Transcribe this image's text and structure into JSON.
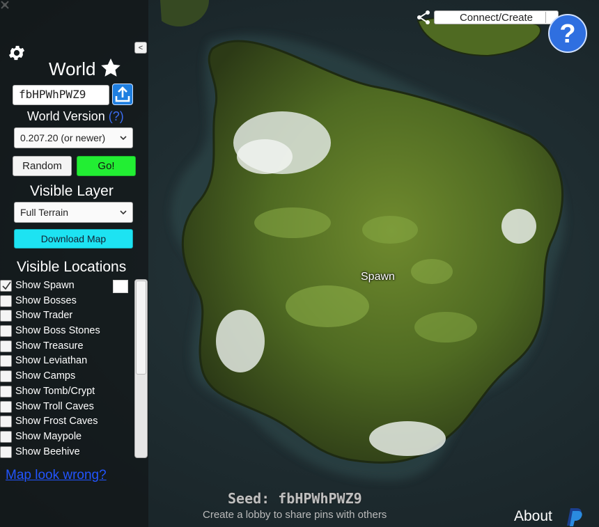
{
  "sidebar": {
    "world_label": "World",
    "collapse_label": "<",
    "seed_value": "fbHPWhPWZ9",
    "world_version_label": "World Version",
    "world_version_help": "(?)",
    "version_selected": "0.207.20 (or newer)",
    "random_label": "Random",
    "go_label": "Go!",
    "visible_layer_label": "Visible Layer",
    "layer_selected": "Full Terrain",
    "download_label": "Download Map",
    "visible_locations_label": "Visible Locations",
    "locations": [
      {
        "label": "Show Spawn",
        "checked": true
      },
      {
        "label": "Show Bosses",
        "checked": false
      },
      {
        "label": "Show Trader",
        "checked": false
      },
      {
        "label": "Show Boss Stones",
        "checked": false
      },
      {
        "label": "Show Treasure",
        "checked": false
      },
      {
        "label": "Show Leviathan",
        "checked": false
      },
      {
        "label": "Show Camps",
        "checked": false
      },
      {
        "label": "Show Tomb/Crypt",
        "checked": false
      },
      {
        "label": "Show Troll Caves",
        "checked": false
      },
      {
        "label": "Show Frost Caves",
        "checked": false
      },
      {
        "label": "Show Maypole",
        "checked": false
      },
      {
        "label": "Show Beehive",
        "checked": false
      }
    ],
    "map_wrong_link": "Map look wrong?"
  },
  "topbar": {
    "connect_label": "Connect/Create"
  },
  "map": {
    "spawn_label": "Spawn"
  },
  "footer": {
    "seed_text": "Seed: fbHPWhPWZ9",
    "lobby_hint": "Create a lobby to share pins with others",
    "about_label": "About"
  },
  "colors": {
    "go_button": "#22ee33",
    "download_button": "#1de3f2",
    "upload_button": "#1f7fe0",
    "link": "#2255ff",
    "help_button": "#2f6fe0"
  },
  "icons": {
    "settings": "gear-icon",
    "favorite": "star-icon",
    "upload": "upload-icon",
    "share": "share-icon",
    "help": "question-icon",
    "donate": "paypal-icon"
  }
}
